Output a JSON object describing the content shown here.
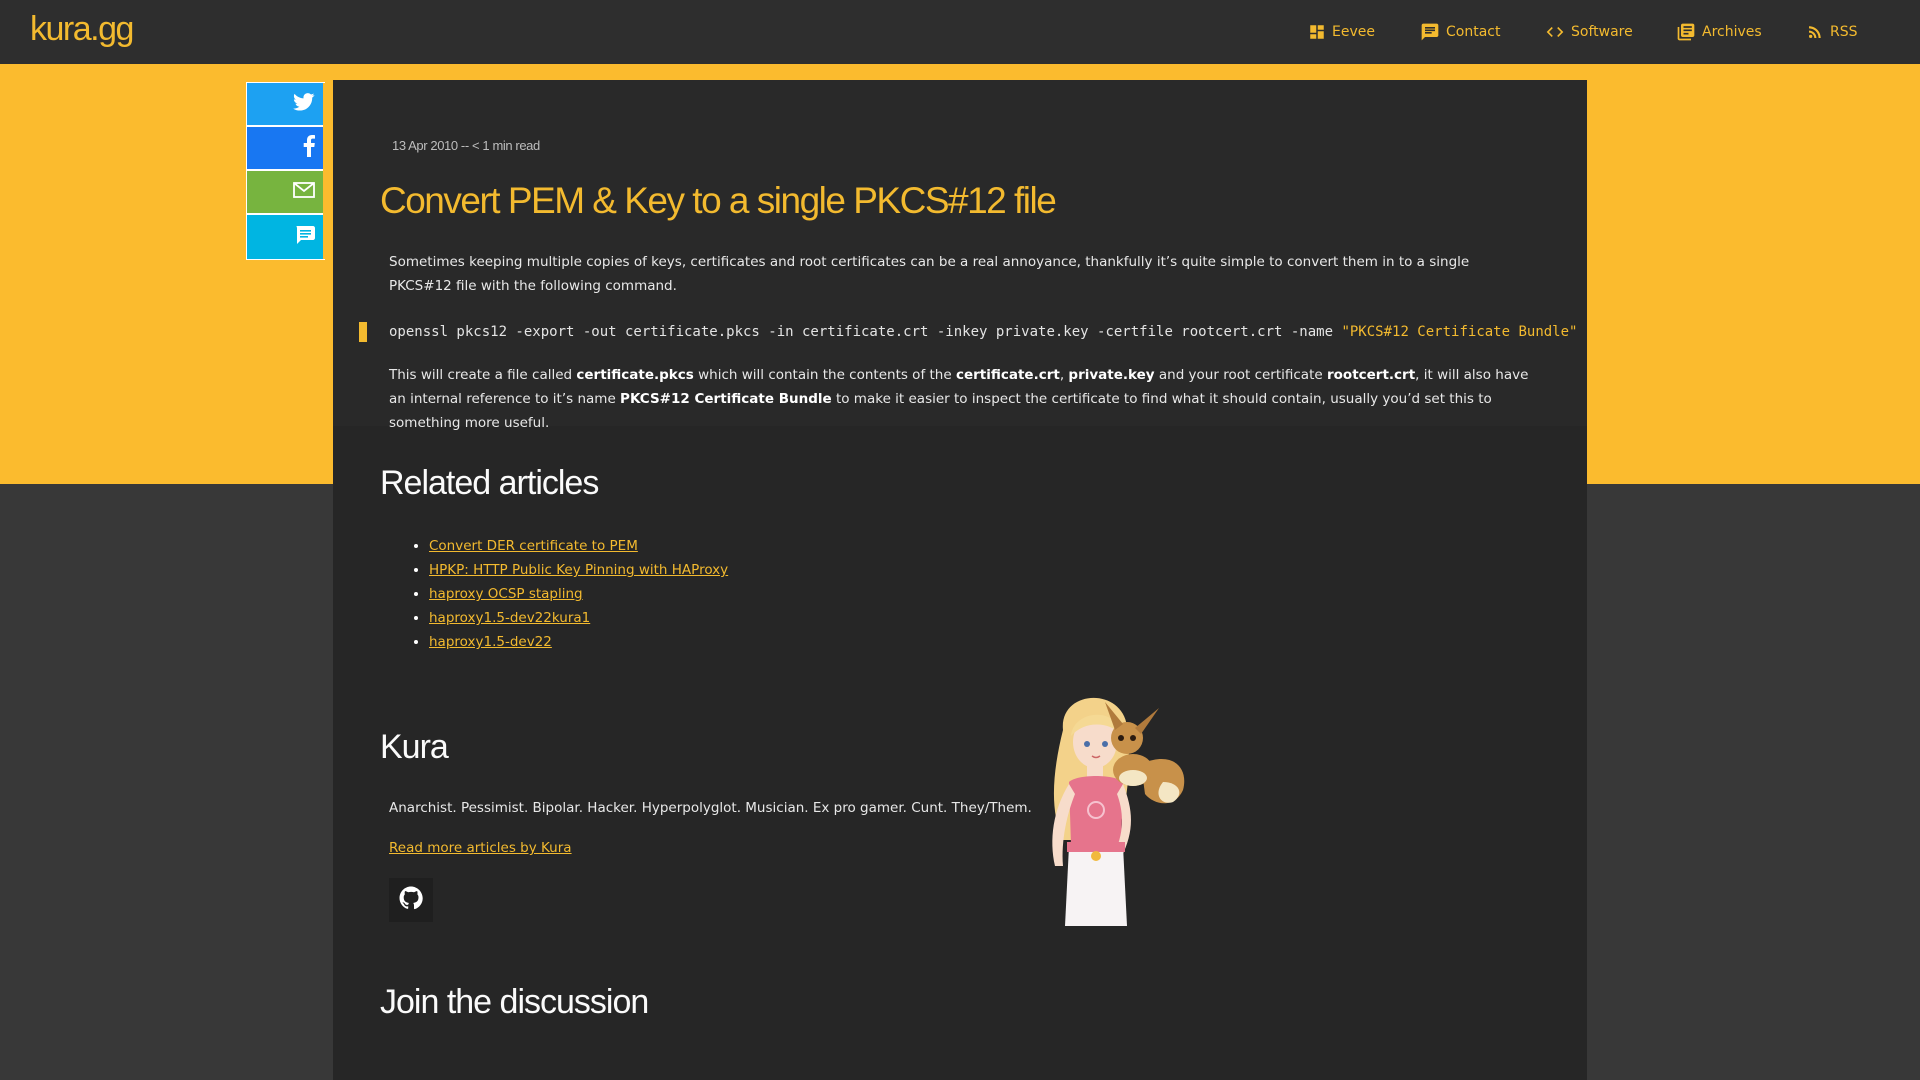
{
  "site": {
    "logo": "kura.gg"
  },
  "nav": [
    {
      "label": "Eevee",
      "icon": "dashboard-icon"
    },
    {
      "label": "Contact",
      "icon": "chat-icon"
    },
    {
      "label": "Software",
      "icon": "code-icon"
    },
    {
      "label": "Archives",
      "icon": "library-icon"
    },
    {
      "label": "RSS",
      "icon": "rss-icon"
    }
  ],
  "share": [
    {
      "name": "twitter",
      "color": "#1da1f2",
      "icon": "twitter-icon"
    },
    {
      "name": "facebook",
      "color": "#1877f2",
      "icon": "facebook-icon"
    },
    {
      "name": "email",
      "color": "#77b43f",
      "icon": "mail-icon"
    },
    {
      "name": "comments",
      "color": "#00b5e2",
      "icon": "comment-icon"
    }
  ],
  "post": {
    "meta": "13 Apr 2010 -- < 1 min read",
    "title": "Convert PEM &  Key to a single PKCS#12 file",
    "intro": "Sometimes keeping multiple copies of keys, certificates and root certificates can be a real annoyance, thankfully it’s quite simple to convert them in to a single PKCS#12 file with the following command.",
    "code_cmd": "openssl pkcs12 -export -out certificate.pkcs -in certificate.crt -inkey private.key -certfile rootcert.crt -name ",
    "code_str": "\"PKCS#12 Certificate Bundle\"",
    "body": {
      "t1": "This will create a file called ",
      "b1": "certificate.pkcs",
      "t2": " which will contain the contents of the ",
      "b2": "certificate.crt",
      "t3": ", ",
      "b3": "private.key",
      "t4": " and your root certificate ",
      "b4": "rootcert.crt",
      "t5": ", it will also have an internal reference to it’s name ",
      "b5": "PKCS#12 Certificate Bundle",
      "t6": " to make it easier to inspect the certificate to find what it should contain, usually you’d set this to something more useful."
    }
  },
  "related": {
    "heading": "Related articles",
    "items": [
      "Convert DER certificate to PEM",
      "HPKP: HTTP Public Key Pinning with HAProxy",
      "haproxy OCSP stapling",
      "haproxy1.5-dev22kura1",
      "haproxy1.5-dev22"
    ]
  },
  "author": {
    "name": "Kura",
    "bio": "Anarchist. Pessimist. Bipolar. Hacker. Hyperpolyglot. Musician. Ex pro gamer. Cunt. They/Them.",
    "more": "Read more articles by Kura",
    "github_icon": "github-icon"
  },
  "discussion": {
    "heading": "Join the discussion"
  },
  "colors": {
    "accent": "#f3ba2f",
    "band": "#fbbb2e",
    "card": "#262626",
    "page": "#383838"
  }
}
